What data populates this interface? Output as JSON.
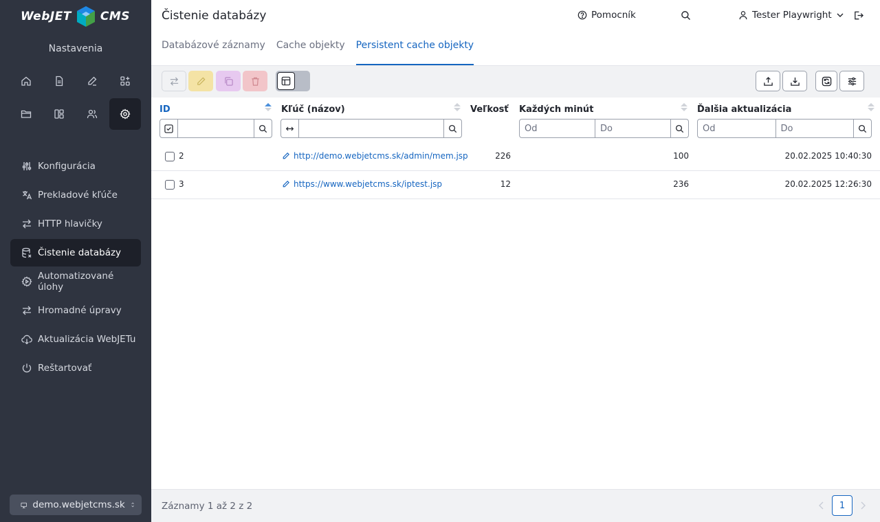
{
  "app": {
    "logo_left": "WebJET",
    "logo_right": "CMS",
    "section": "Nastavenia"
  },
  "sidebar": {
    "icons": [
      "home-icon",
      "document-icon",
      "edit-icon",
      "apps-icon",
      "folder-icon",
      "layout-icon",
      "users-icon",
      "gear-icon"
    ],
    "items": [
      {
        "label": "Konfigurácia",
        "icon": "sliders-icon"
      },
      {
        "label": "Prekladové kľúče",
        "icon": "translate-icon"
      },
      {
        "label": "HTTP hlavičky",
        "icon": "arrows-icon"
      },
      {
        "label": "Čistenie databázy",
        "icon": "database-clean-icon"
      },
      {
        "label": "Automatizované úlohy",
        "icon": "automation-icon"
      },
      {
        "label": "Hromadné úpravy",
        "icon": "bulk-edit-icon"
      },
      {
        "label": "Aktualizácia WebJETu",
        "icon": "cloud-download-icon"
      },
      {
        "label": "Reštartovať",
        "icon": "power-icon"
      }
    ],
    "domain": "demo.webjetcms.sk"
  },
  "header": {
    "title": "Čistenie databázy",
    "help": "Pomocník",
    "user": "Tester Playwright",
    "tabs": [
      "Databázové záznamy",
      "Cache objekty",
      "Persistent cache objekty"
    ]
  },
  "table": {
    "columns": {
      "id": "ID",
      "key": "Kľúč (názov)",
      "size": "Veľkosť",
      "every_minutes": "Každých minút",
      "next_update": "Ďalšia aktualizácia"
    },
    "filters": {
      "from": "Od",
      "to": "Do"
    },
    "rows": [
      {
        "id": "2",
        "key": "http://demo.webjetcms.sk/admin/mem.jsp",
        "size": "226",
        "minutes": "100",
        "next": "20.02.2025 10:40:30"
      },
      {
        "id": "3",
        "key": "https://www.webjetcms.sk/iptest.jsp",
        "size": "12",
        "minutes": "236",
        "next": "20.02.2025 12:26:30"
      }
    ]
  },
  "footer": {
    "records": "Záznamy 1 až 2 z 2",
    "page": "1"
  }
}
